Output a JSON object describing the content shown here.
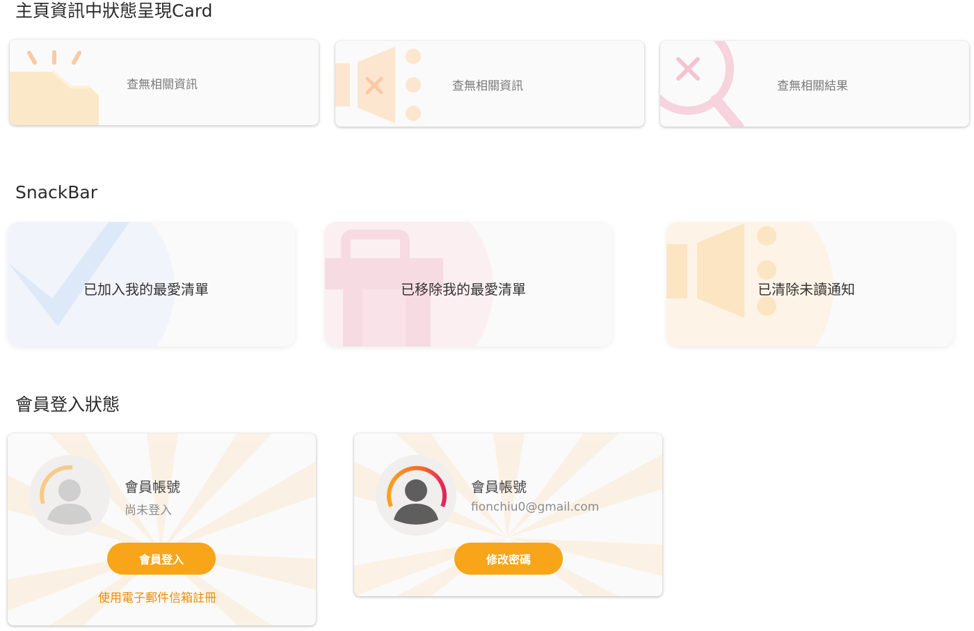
{
  "sections": {
    "empty_state_title": "主頁資訊中狀態呈現Card",
    "snackbar_title": "SnackBar",
    "member_title": "會員登入狀態"
  },
  "empty_cards": [
    {
      "message": "查無相關資訊",
      "icon": "folder-icon"
    },
    {
      "message": "查無相關資訊",
      "icon": "megaphone-muted-icon"
    },
    {
      "message": "查無相關結果",
      "icon": "search-no-result-icon"
    }
  ],
  "snackbars": [
    {
      "message": "已加入我的最愛清單",
      "icon": "check-icon",
      "color": "#dce9f8"
    },
    {
      "message": "已移除我的最愛清單",
      "icon": "trash-icon",
      "color": "#f6dbe2"
    },
    {
      "message": "已清除未讀通知",
      "icon": "megaphone-icon",
      "color": "#fbe5c3"
    }
  ],
  "members": [
    {
      "account_label": "會員帳號",
      "status": "尚未登入",
      "button": "會員登入",
      "link": "使用電子郵件信箱註冊"
    },
    {
      "account_label": "會員帳號",
      "status": "fionchiu0@gmail.com",
      "button": "修改密碼"
    }
  ],
  "colors": {
    "accent": "#f8a519",
    "link": "#f08c00"
  }
}
